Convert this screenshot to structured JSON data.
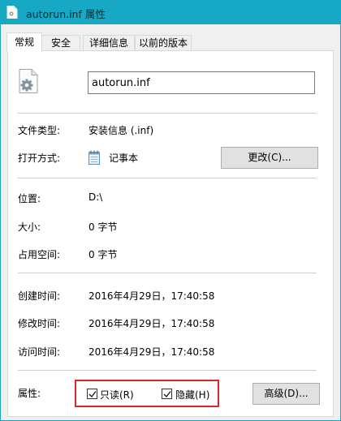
{
  "window": {
    "title": "autorun.inf 属性",
    "title_icon": "document-gear-icon",
    "titlebar_color": "#17a8c6"
  },
  "tabs": [
    {
      "label": "常规",
      "active": true
    },
    {
      "label": "安全",
      "active": false
    },
    {
      "label": "详细信息",
      "active": false
    },
    {
      "label": "以前的版本",
      "active": false
    }
  ],
  "general": {
    "file_icon": "document-gear-icon",
    "file_name": "autorun.inf",
    "file_type_label": "文件类型:",
    "file_type_value": "安装信息 (.inf)",
    "opens_with_label": "打开方式:",
    "opens_with_icon": "notepad-icon",
    "opens_with_value": "记事本",
    "change_button": "更改(C)...",
    "location_label": "位置:",
    "location_value": "D:\\",
    "size_label": "大小:",
    "size_value": "0 字节",
    "size_on_disk_label": "占用空间:",
    "size_on_disk_value": "0 字节",
    "created_label": "创建时间:",
    "created_value": "2016年4月29日，17:40:58",
    "modified_label": "修改时间:",
    "modified_value": "2016年4月29日，17:40:58",
    "accessed_label": "访问时间:",
    "accessed_value": "2016年4月29日，17:40:58",
    "attributes_label": "属性:",
    "readonly_label": "只读(R)",
    "readonly_checked": true,
    "hidden_label": "隐藏(H)",
    "hidden_checked": true,
    "advanced_button": "高级(D)...",
    "highlight_color": "#e0252b"
  }
}
